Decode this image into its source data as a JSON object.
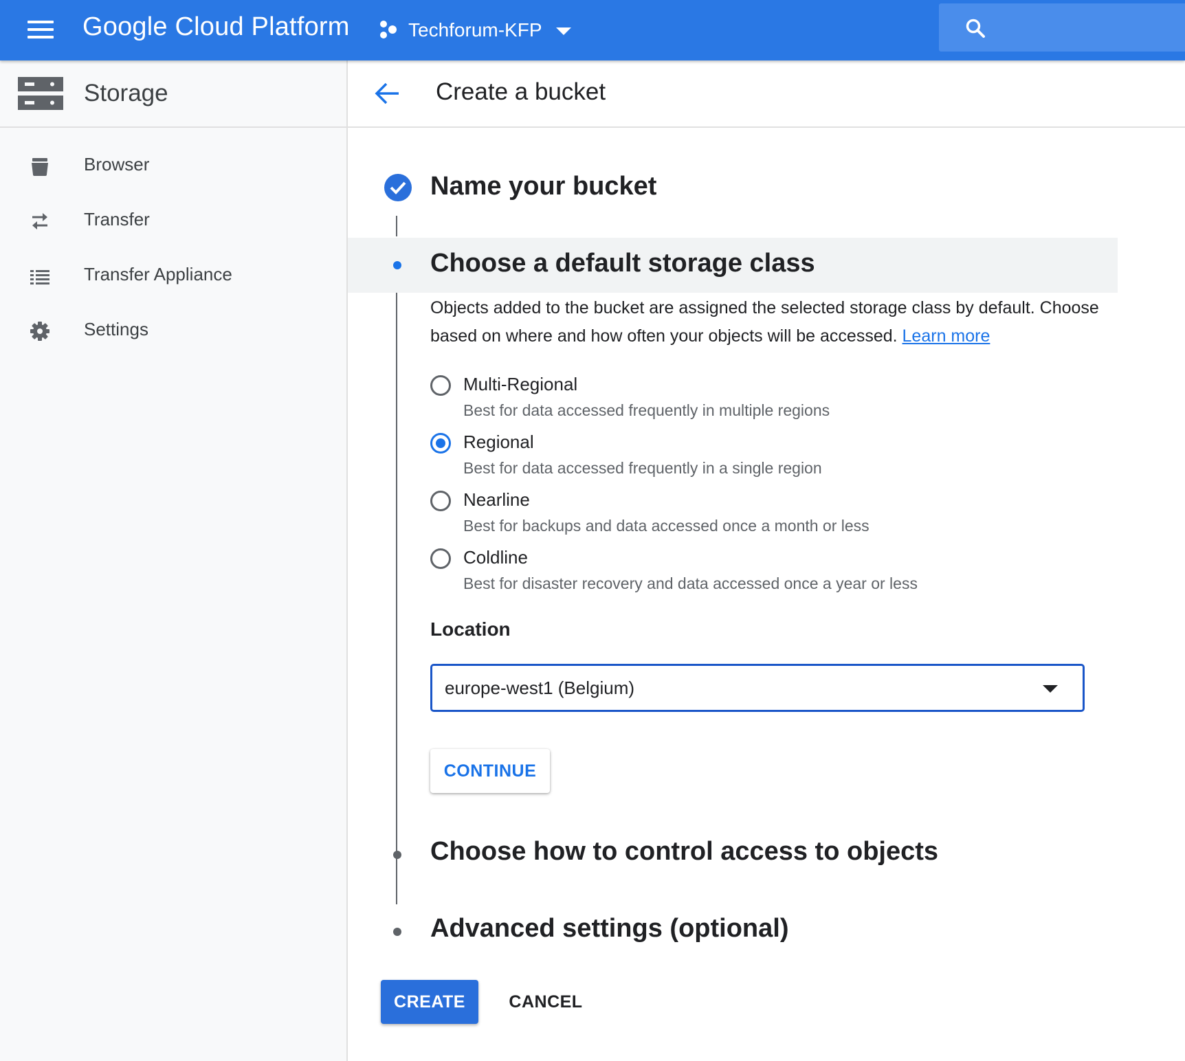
{
  "topbar": {
    "menu_icon": "hamburger-menu-icon",
    "app_title": "Google Cloud Platform",
    "project_name": "Techforum-KFP",
    "project_icon": "project-hexagon-icon",
    "search_icon": "search-icon",
    "color": "#2a78e4"
  },
  "sidebar": {
    "title": "Storage",
    "icon": "storage-icon",
    "items": [
      {
        "label": "Browser",
        "icon": "bucket-icon"
      },
      {
        "label": "Transfer",
        "icon": "swap-arrows-icon"
      },
      {
        "label": "Transfer Appliance",
        "icon": "list-icon"
      },
      {
        "label": "Settings",
        "icon": "gear-icon"
      }
    ]
  },
  "header": {
    "back_icon": "arrow-back-icon",
    "title": "Create a bucket"
  },
  "steps": {
    "step1": {
      "title": "Name your bucket",
      "status": "completed",
      "icon": "check-circle-icon"
    },
    "step2": {
      "title": "Choose a default storage class",
      "status": "active",
      "description": "Objects added to the bucket are assigned the selected storage class by default. Choose based on where and how often your objects will be accessed.",
      "learn_more": "Learn more",
      "options": [
        {
          "label": "Multi-Regional",
          "description": "Best for data accessed frequently in multiple regions",
          "checked": false
        },
        {
          "label": "Regional",
          "description": "Best for data accessed frequently in a single region",
          "checked": true
        },
        {
          "label": "Nearline",
          "description": "Best for backups and data accessed once a month or less",
          "checked": false
        },
        {
          "label": "Coldline",
          "description": "Best for disaster recovery and data accessed once a year or less",
          "checked": false
        }
      ],
      "location_label": "Location",
      "location_value": "europe-west1 (Belgium)",
      "continue_label": "CONTINUE"
    },
    "step3": {
      "title": "Choose how to control access to objects",
      "status": "pending"
    },
    "step4": {
      "title": "Advanced settings (optional)",
      "status": "pending"
    }
  },
  "actions": {
    "create_label": "CREATE",
    "cancel_label": "CANCEL"
  },
  "colors": {
    "accent": "#1a73e8",
    "topbar": "#2a78e4",
    "primary_button": "#2a6fdb"
  }
}
